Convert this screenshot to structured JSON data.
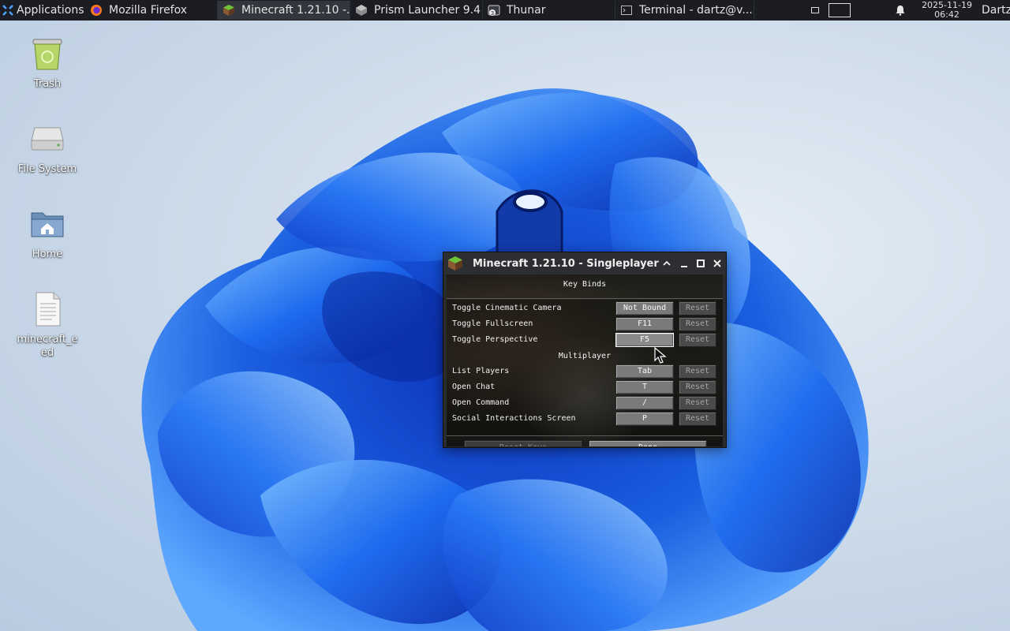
{
  "taskbar": {
    "applications_label": "Applications",
    "tasks": [
      {
        "label": "Mozilla Firefox",
        "icon": "firefox-icon",
        "active": false
      },
      {
        "label": "Minecraft 1.21.10 -...",
        "icon": "minecraft-icon",
        "active": true
      },
      {
        "label": "Prism Launcher 9.4",
        "icon": "prism-launcher-icon",
        "active": false
      },
      {
        "label": "Thunar",
        "icon": "thunar-icon",
        "badge": "3",
        "active": false
      },
      {
        "label": "Terminal - dartz@v...",
        "icon": "terminal-icon",
        "active": false
      }
    ],
    "clock": {
      "date": "2025-11-19",
      "time": "06:42"
    },
    "user": "Dartz"
  },
  "desktop": {
    "icons": [
      {
        "label": "Trash",
        "icon": "trash-icon"
      },
      {
        "label": "File System",
        "icon": "drive-icon"
      },
      {
        "label": "Home",
        "icon": "home-folder-icon"
      },
      {
        "label": "minecraft_eed",
        "icon": "text-file-icon"
      }
    ]
  },
  "minecraft_window": {
    "title": "Minecraft 1.21.10 - Singleplayer",
    "heading": "Key Binds",
    "keybinds": [
      {
        "label": "Toggle Cinematic Camera",
        "key": "Not Bound",
        "reset": "Reset"
      },
      {
        "label": "Toggle Fullscreen",
        "key": "F11",
        "reset": "Reset"
      },
      {
        "label": "Toggle Perspective",
        "key": "F5",
        "reset": "Reset"
      }
    ],
    "category": "Multiplayer",
    "multiplayer_keybinds": [
      {
        "label": "List Players",
        "key": "Tab",
        "reset": "Reset"
      },
      {
        "label": "Open Chat",
        "key": "T",
        "reset": "Reset"
      },
      {
        "label": "Open Command",
        "key": "/",
        "reset": "Reset"
      },
      {
        "label": "Social Interactions Screen",
        "key": "P",
        "reset": "Reset"
      }
    ],
    "reset_keys_label": "Reset Keys",
    "done_label": "Done"
  },
  "colors": {
    "wallpaper_accent": "#1a5fe0",
    "taskbar_bg": "#1b1d22",
    "mc_button": "#7a7a7a"
  }
}
